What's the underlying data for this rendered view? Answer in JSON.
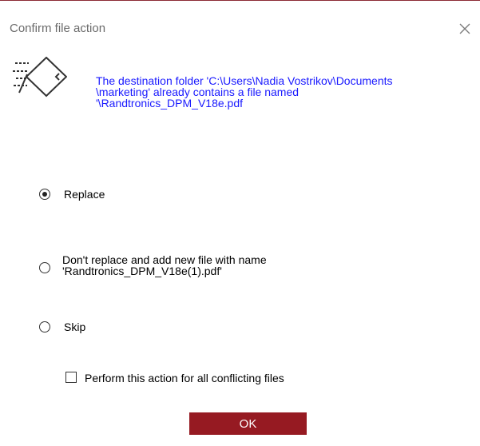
{
  "dialog": {
    "title": "Confirm file action",
    "message_lines": [
      "The destination folder 'C:\\Users\\Nadia Vostrikov\\Documents",
      "\\marketing' already contains a file named",
      "'\\Randtronics_DPM_V18e.pdf"
    ]
  },
  "options": {
    "replace": {
      "label": "Replace",
      "selected": true
    },
    "rename": {
      "label_line1": "Don't replace and add new file with name",
      "label_line2": "'Randtronics_DPM_V18e(1).pdf'",
      "selected": false
    },
    "skip": {
      "label": "Skip",
      "selected": false
    }
  },
  "apply_all": {
    "label": "Perform this action for all conflicting files",
    "checked": false
  },
  "ok_button": {
    "label": "OK"
  },
  "colors": {
    "accent": "#961a22",
    "message_text": "#1a1aff",
    "title_text": "#6b6b6b"
  }
}
